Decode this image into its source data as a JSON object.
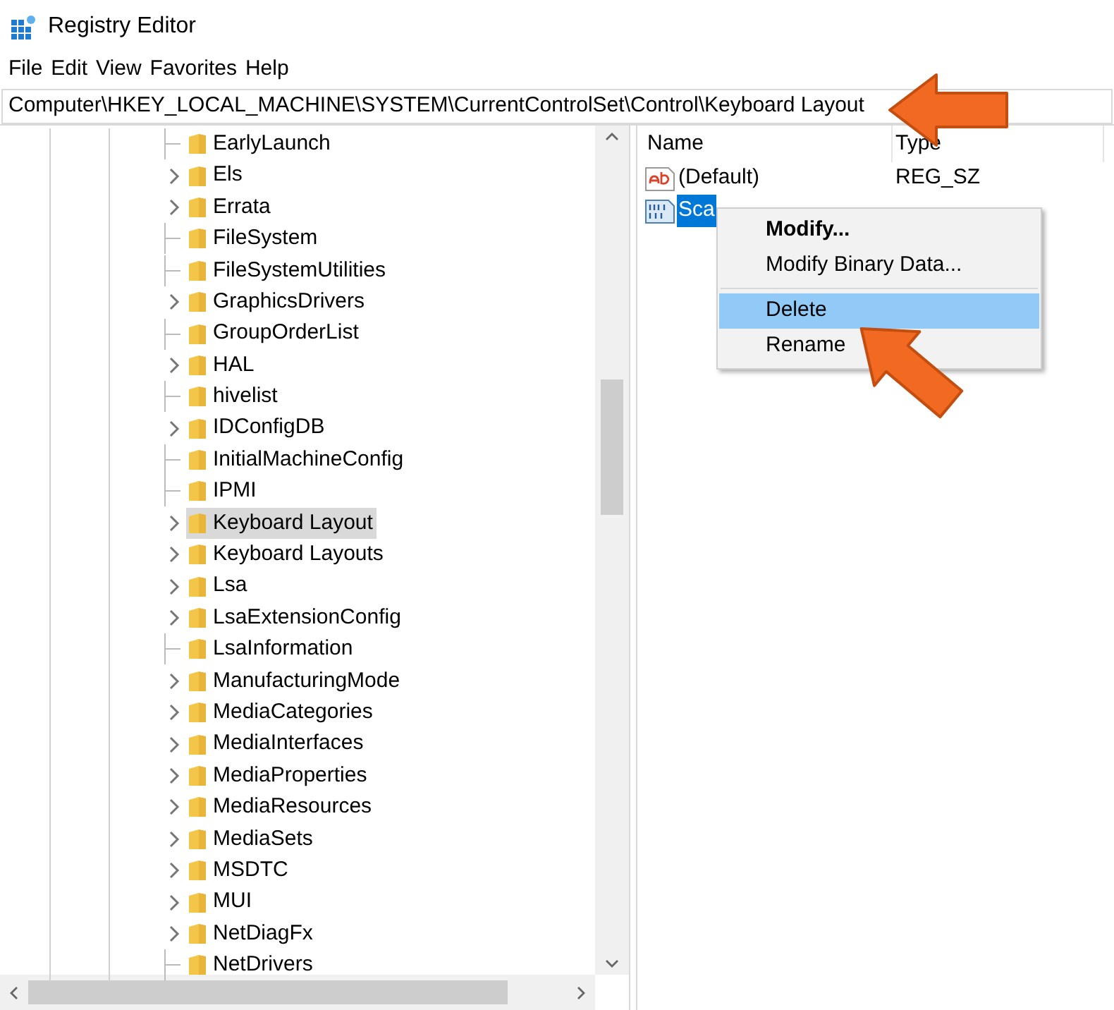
{
  "window": {
    "title": "Registry Editor"
  },
  "menu_bar": [
    "File",
    "Edit",
    "View",
    "Favorites",
    "Help"
  ],
  "address": "Computer\\HKEY_LOCAL_MACHINE\\SYSTEM\\CurrentControlSet\\Control\\Keyboard Layout",
  "tree": {
    "keys": [
      {
        "label": "EarlyLaunch",
        "expandable": false,
        "selected": false
      },
      {
        "label": "Els",
        "expandable": true,
        "selected": false
      },
      {
        "label": "Errata",
        "expandable": true,
        "selected": false
      },
      {
        "label": "FileSystem",
        "expandable": false,
        "selected": false
      },
      {
        "label": "FileSystemUtilities",
        "expandable": false,
        "selected": false
      },
      {
        "label": "GraphicsDrivers",
        "expandable": true,
        "selected": false
      },
      {
        "label": "GroupOrderList",
        "expandable": false,
        "selected": false
      },
      {
        "label": "HAL",
        "expandable": true,
        "selected": false
      },
      {
        "label": "hivelist",
        "expandable": false,
        "selected": false
      },
      {
        "label": "IDConfigDB",
        "expandable": true,
        "selected": false
      },
      {
        "label": "InitialMachineConfig",
        "expandable": false,
        "selected": false
      },
      {
        "label": "IPMI",
        "expandable": false,
        "selected": false
      },
      {
        "label": "Keyboard Layout",
        "expandable": true,
        "selected": true
      },
      {
        "label": "Keyboard Layouts",
        "expandable": true,
        "selected": false
      },
      {
        "label": "Lsa",
        "expandable": true,
        "selected": false
      },
      {
        "label": "LsaExtensionConfig",
        "expandable": true,
        "selected": false
      },
      {
        "label": "LsaInformation",
        "expandable": false,
        "selected": false
      },
      {
        "label": "ManufacturingMode",
        "expandable": true,
        "selected": false
      },
      {
        "label": "MediaCategories",
        "expandable": true,
        "selected": false
      },
      {
        "label": "MediaInterfaces",
        "expandable": true,
        "selected": false
      },
      {
        "label": "MediaProperties",
        "expandable": true,
        "selected": false
      },
      {
        "label": "MediaResources",
        "expandable": true,
        "selected": false
      },
      {
        "label": "MediaSets",
        "expandable": true,
        "selected": false
      },
      {
        "label": "MSDTC",
        "expandable": true,
        "selected": false
      },
      {
        "label": "MUI",
        "expandable": true,
        "selected": false
      },
      {
        "label": "NetDiagFx",
        "expandable": true,
        "selected": false
      },
      {
        "label": "NetDrivers",
        "expandable": false,
        "selected": false
      }
    ]
  },
  "values": {
    "columns": [
      "Name",
      "Type"
    ],
    "rows": [
      {
        "kind": "string",
        "name": "(Default)",
        "type": "REG_SZ",
        "selected": false
      },
      {
        "kind": "binary",
        "name": "Sca",
        "selected": true
      }
    ]
  },
  "context_menu": [
    {
      "label": "Modify...",
      "default": true,
      "selected": false
    },
    {
      "label": "Modify Binary Data...",
      "default": false,
      "selected": false
    },
    {
      "kind": "separator"
    },
    {
      "label": "Delete",
      "default": false,
      "selected": true
    },
    {
      "label": "Rename",
      "default": false,
      "selected": false
    }
  ]
}
